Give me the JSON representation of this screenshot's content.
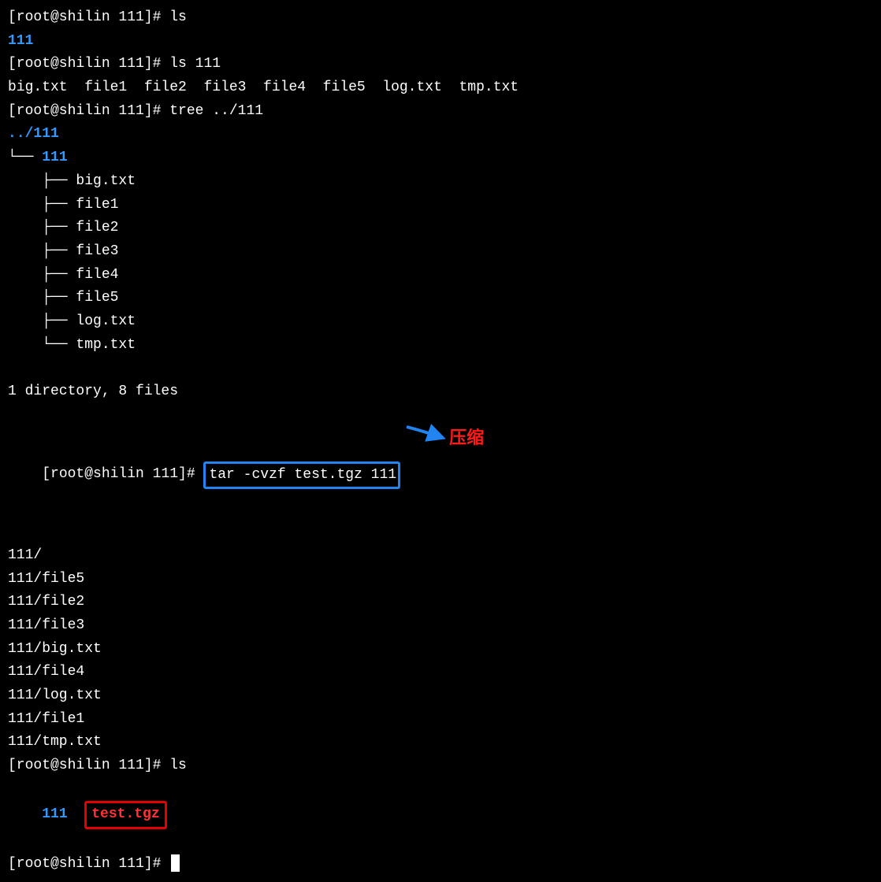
{
  "prompt": "[root@shilin 111]# ",
  "cmd1": "ls",
  "out1_dir": "111",
  "cmd2": "ls 111",
  "out2_files": "big.txt  file1  file2  file3  file4  file5  log.txt  tmp.txt",
  "cmd3": "tree ../111",
  "tree_root": "../111",
  "tree_branch_dir": "└── ",
  "tree_dir": "111",
  "tree_files": [
    "    ├── big.txt",
    "    ├── file1",
    "    ├── file2",
    "    ├── file3",
    "    ├── file4",
    "    ├── file5",
    "    ├── log.txt",
    "    └── tmp.txt"
  ],
  "tree_summary": "1 directory, 8 files",
  "cmd4_pre": "",
  "cmd4_box": "tar -cvzf test.tgz 111",
  "annotation": "压缩",
  "tar_output": [
    "111/",
    "111/file5",
    "111/file2",
    "111/file3",
    "111/big.txt",
    "111/file4",
    "111/log.txt",
    "111/file1",
    "111/tmp.txt"
  ],
  "cmd5": "ls",
  "out5_dir": "111",
  "out5_file_box": "test.tgz"
}
